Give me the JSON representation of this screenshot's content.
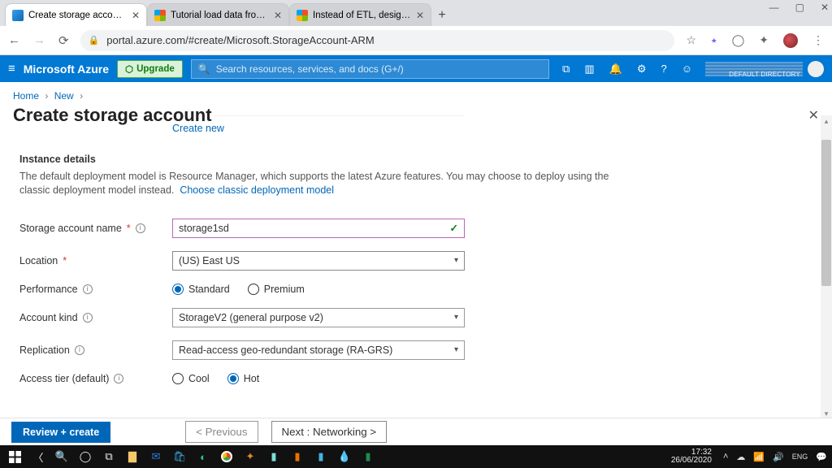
{
  "chrome": {
    "tabs": [
      {
        "title": "Create storage account - Micro"
      },
      {
        "title": "Tutorial load data from Azure B"
      },
      {
        "title": "Instead of ETL, design ELT - Az"
      }
    ],
    "url": "portal.azure.com/#create/Microsoft.StorageAccount-ARM",
    "win_min": "—",
    "win_max": "▢",
    "win_close": "✕"
  },
  "azure": {
    "brand": "Microsoft Azure",
    "upgrade": "Upgrade",
    "search_placeholder": "Search resources, services, and docs (G+/)",
    "directory": "DEFAULT DIRECTORY"
  },
  "crumbs": {
    "home": "Home",
    "new": "New"
  },
  "page": {
    "title": "Create storage account",
    "create_new": "Create new",
    "section_head": "Instance details",
    "section_desc": "The default deployment model is Resource Manager, which supports the latest Azure features. You may choose to deploy using the classic deployment model instead.",
    "section_link": "Choose classic deployment model"
  },
  "fields": {
    "name_label": "Storage account name",
    "name_value": "storage1sd",
    "location_label": "Location",
    "location_value": "(US) East US",
    "perf_label": "Performance",
    "perf_standard": "Standard",
    "perf_premium": "Premium",
    "kind_label": "Account kind",
    "kind_value": "StorageV2 (general purpose v2)",
    "repl_label": "Replication",
    "repl_value": "Read-access geo-redundant storage (RA-GRS)",
    "tier_label": "Access tier (default)",
    "tier_cool": "Cool",
    "tier_hot": "Hot"
  },
  "buttons": {
    "review": "Review + create",
    "prev": "< Previous",
    "next": "Next : Networking >"
  },
  "taskbar": {
    "time": "17:32",
    "date": "26/06/2020"
  }
}
